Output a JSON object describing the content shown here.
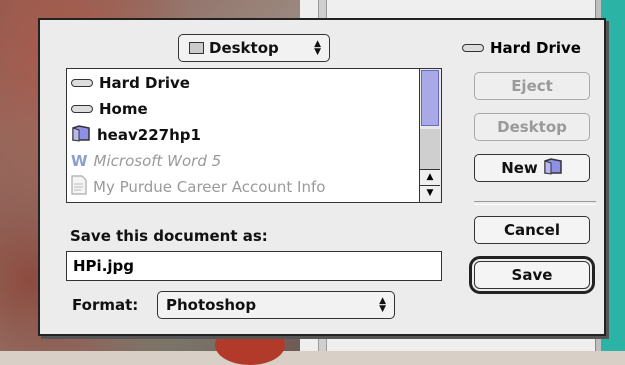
{
  "location_popup": {
    "label": "Desktop"
  },
  "volume": {
    "label": "Hard Drive"
  },
  "file_list": [
    {
      "label": "Hard Drive",
      "icon": "hard-drive-icon",
      "enabled": true
    },
    {
      "label": "Home",
      "icon": "hard-drive-icon",
      "enabled": true
    },
    {
      "label": "heav227hp1",
      "icon": "folder-icon",
      "enabled": true
    },
    {
      "label": "Microsoft Word 5",
      "icon": "word-doc-icon",
      "enabled": false
    },
    {
      "label": "My Purdue Career Account Info",
      "icon": "document-icon",
      "enabled": false
    }
  ],
  "buttons": {
    "eject": "Eject",
    "desktop": "Desktop",
    "new": "New",
    "cancel": "Cancel",
    "save": "Save"
  },
  "save_as": {
    "label": "Save this document as:",
    "value": "HPi.jpg"
  },
  "format": {
    "label": "Format:",
    "value": "Photoshop"
  }
}
